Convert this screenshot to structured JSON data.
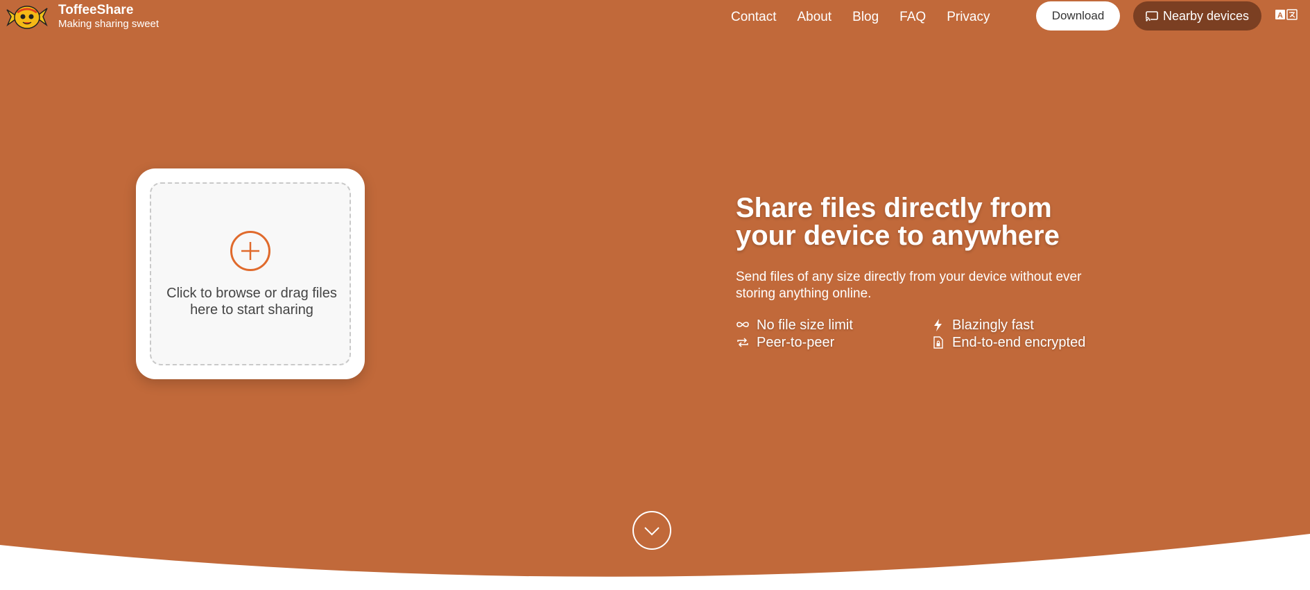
{
  "brand": {
    "name": "ToffeeShare",
    "tagline": "Making sharing sweet",
    "logo": "candy-logo"
  },
  "nav": {
    "items": [
      "Contact",
      "About",
      "Blog",
      "FAQ",
      "Privacy"
    ]
  },
  "header": {
    "download_label": "Download",
    "nearby_label": "Nearby devices",
    "nearby_icon": "cast-icon",
    "language_icon": "translate-icon"
  },
  "upload": {
    "prompt": "Click to browse or drag files here to start sharing",
    "icon": "plus-circle-icon"
  },
  "hero": {
    "headline": "Share files directly from your device to anywhere",
    "subtext": "Send files of any size directly from your device without ever storing anything online.",
    "features": [
      {
        "label": "No file size limit",
        "icon": "infinity-icon"
      },
      {
        "label": "Blazingly fast",
        "icon": "lightning-icon"
      },
      {
        "label": "Peer-to-peer",
        "icon": "repeat-icon"
      },
      {
        "label": "End-to-end encrypted",
        "icon": "lock-file-icon"
      }
    ]
  },
  "scroll": {
    "icon": "chevron-down-icon"
  },
  "colors": {
    "accent": "#c1693a",
    "dark_button": "#7b3f22",
    "plus": "#e06a2c"
  }
}
